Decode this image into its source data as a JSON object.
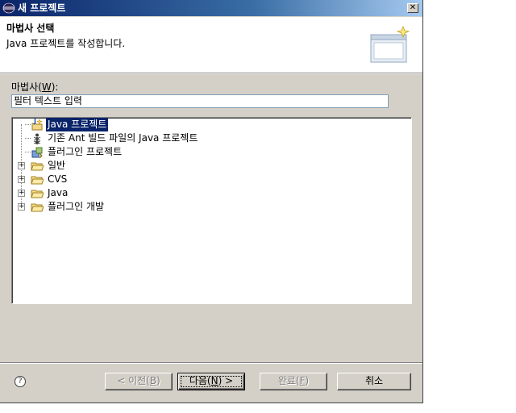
{
  "window": {
    "title": "새 프로젝트",
    "close_glyph": "✕"
  },
  "header": {
    "title": "마법사 선택",
    "description": "Java 프로젝트를 작성합니다."
  },
  "filter": {
    "label_prefix": "마법사(",
    "label_mnemonic": "W",
    "label_suffix": "):",
    "value": "필터 텍스트 입력"
  },
  "tree": {
    "items": [
      {
        "label": "Java 프로젝트",
        "icon": "java-project-icon",
        "selected": true
      },
      {
        "label": "기존 Ant 빌드 파일의 Java 프로젝트",
        "icon": "ant-icon"
      },
      {
        "label": "플러그인 프로젝트",
        "icon": "plugin-project-icon"
      },
      {
        "label": "일반",
        "icon": "folder-icon",
        "expander": "+"
      },
      {
        "label": "CVS",
        "icon": "folder-icon",
        "expander": "+"
      },
      {
        "label": "Java",
        "icon": "folder-icon",
        "expander": "+"
      },
      {
        "label": "플러그인 개발",
        "icon": "folder-icon",
        "expander": "+"
      }
    ]
  },
  "buttons": {
    "help_glyph": "?",
    "back": {
      "prefix": "< 이전(",
      "mnemonic": "B",
      "suffix": ")"
    },
    "next": {
      "prefix": "다음(",
      "mnemonic": "N",
      "suffix": ") >"
    },
    "finish": {
      "prefix": "완료(",
      "mnemonic": "F",
      "suffix": ")"
    },
    "cancel": "취소"
  }
}
